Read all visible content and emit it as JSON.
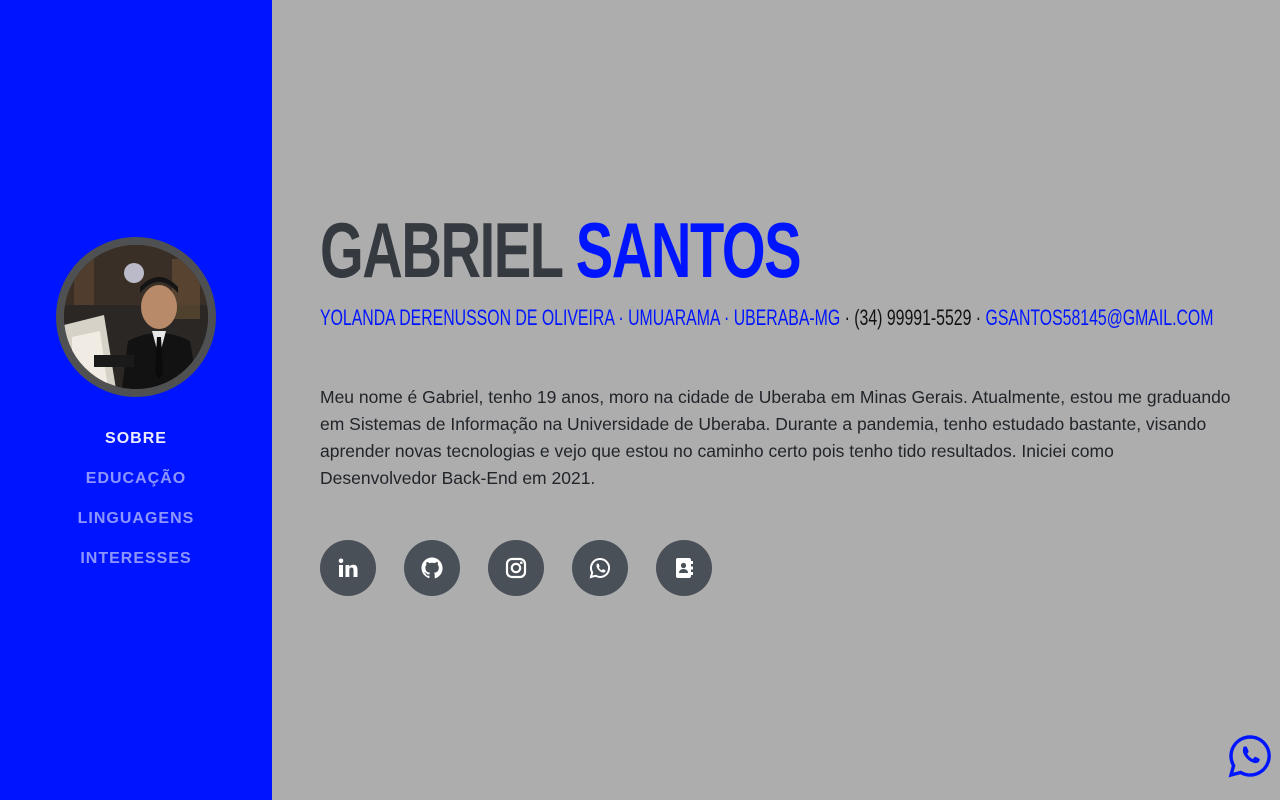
{
  "sidebar": {
    "nav": [
      {
        "label": "SOBRE",
        "active": true
      },
      {
        "label": "EDUCAÇÃO",
        "active": false
      },
      {
        "label": "LINGUAGENS",
        "active": false
      },
      {
        "label": "INTERESSES",
        "active": false
      }
    ]
  },
  "header": {
    "first_name": "GABRIEL",
    "last_name": "SANTOS",
    "address": "YOLANDA DERENUSSON DE OLIVEIRA · UMUARAMA · UBERABA-MG",
    "separator1": " · ",
    "phone": "(34) 99991-5529",
    "separator2": " · ",
    "email": "GSANTOS58145@GMAIL.COM"
  },
  "about": {
    "text": "Meu nome é Gabriel, tenho 19 anos, moro na cidade de Uberaba em Minas Gerais. Atualmente, estou me graduando em Sistemas de Informação na Universidade de Uberaba. Durante a pandemia, tenho estudado bastante, visando aprender novas tecnologias e vejo que estou no caminho certo pois tenho tido resultados. Iniciei como Desenvolvedor Back-End em 2021."
  },
  "social": [
    "linkedin-icon",
    "github-icon",
    "instagram-icon",
    "whatsapp-icon",
    "contact-book-icon"
  ],
  "colors": {
    "accent": "#0015ff",
    "background": "#adadad",
    "social_bg": "#495057",
    "name_dark": "#343a40"
  }
}
